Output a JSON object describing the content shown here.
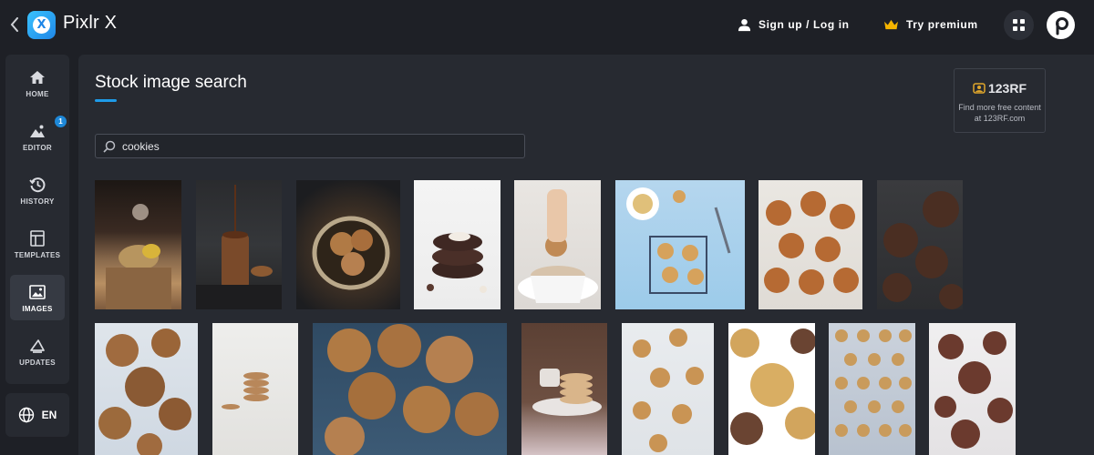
{
  "app": {
    "title": "Pixlr X"
  },
  "header": {
    "signup_label": "Sign up / Log in",
    "premium_label": "Try premium",
    "premium_color": "#f5b400"
  },
  "sidebar": {
    "items": [
      {
        "label": "HOME",
        "icon": "home-icon"
      },
      {
        "label": "EDITOR",
        "icon": "editor-icon",
        "badge": "1"
      },
      {
        "label": "HISTORY",
        "icon": "history-icon"
      },
      {
        "label": "TEMPLATES",
        "icon": "templates-icon"
      },
      {
        "label": "IMAGES",
        "icon": "images-icon",
        "active": true
      },
      {
        "label": "UPDATES",
        "icon": "updates-icon"
      }
    ],
    "language": "EN"
  },
  "main": {
    "title": "Stock image search",
    "search": {
      "value": "cookies",
      "placeholder": ""
    },
    "promo": {
      "brand": "123RF",
      "text_line1": "Find more free content",
      "text_line2": "at 123RF.com"
    },
    "images": [
      {
        "subject": "cookies with sugar sifting on wooden board"
      },
      {
        "subject": "chocolate dripping on stacked cookies"
      },
      {
        "subject": "chocolate chip cookies in basket"
      },
      {
        "subject": "chocolate cookie stack"
      },
      {
        "subject": "cookie dipped in coffee cup"
      },
      {
        "subject": "cookies on cooling rack with coffee"
      },
      {
        "subject": "gingerbread cookies"
      },
      {
        "subject": "chocolate cookies on dark surface"
      },
      {
        "subject": "chocolate chunk cookies on white"
      },
      {
        "subject": "small stack of cookies"
      },
      {
        "subject": "chocolate chip cookies in blue box"
      },
      {
        "subject": "stack of shortbread cookies with tea"
      },
      {
        "subject": "scattered chocolate chip cookies"
      },
      {
        "subject": "cookies on white background"
      },
      {
        "subject": "rows of cookies on marble"
      },
      {
        "subject": "double chocolate cookies"
      }
    ]
  }
}
